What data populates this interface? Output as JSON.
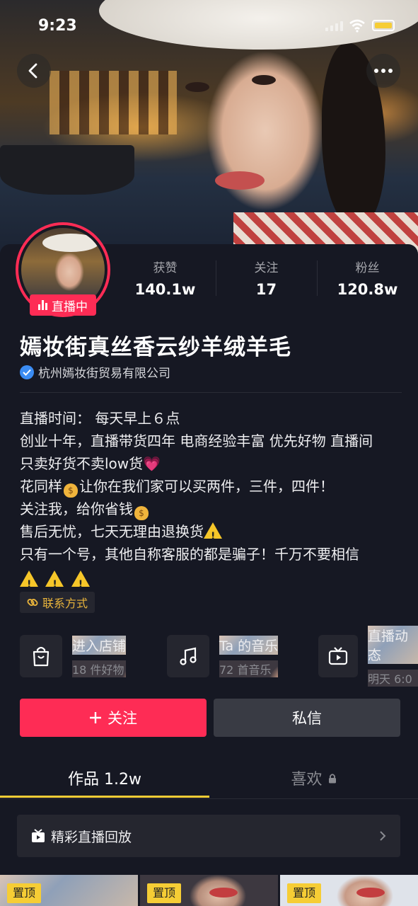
{
  "status_bar": {
    "time": "9:23"
  },
  "profile": {
    "live_badge": "直播中",
    "stats": [
      {
        "label": "获赞",
        "value": "140.1w"
      },
      {
        "label": "关注",
        "value": "17"
      },
      {
        "label": "粉丝",
        "value": "120.8w"
      }
    ],
    "name": "嫣妆街真丝香云纱羊绒羊毛",
    "verified_company": "杭州嫣妆街贸易有限公司",
    "bio": {
      "line1": "直播时间： 每天早上６点",
      "line2": "创业十年，直播带货四年 电商经验丰富 优先好物 直播间",
      "line3": "只卖好货不卖low货",
      "line4a": "花同样",
      "line4b": "让你在我们家可以买两件，三件，四件！",
      "line5": "关注我，给你省钱",
      "line6": "售后无忧，七天无理由退换货",
      "line7": "只有一个号，其他自称客服的都是骗子！千万不要相信"
    },
    "contact_label": "联系方式"
  },
  "shortcuts": [
    {
      "title": "进入店铺",
      "subtitle": "18 件好物",
      "icon": "shopping-bag-icon"
    },
    {
      "title": "Ta 的音乐",
      "subtitle": "72 首音乐",
      "icon": "music-note-icon"
    },
    {
      "title": "直播动态",
      "subtitle": "明天 6:0",
      "icon": "tv-play-icon"
    }
  ],
  "actions": {
    "follow": "关注",
    "message": "私信"
  },
  "tabs": {
    "works": "作品 1.2w",
    "likes": "喜欢"
  },
  "replay": {
    "label": "精彩直播回放"
  },
  "thumbnails": {
    "pin_label": "置顶"
  },
  "colors": {
    "accent": "#fe2c55",
    "background": "#161823",
    "highlight": "#f6cd35",
    "verified": "#3b8cf3"
  }
}
